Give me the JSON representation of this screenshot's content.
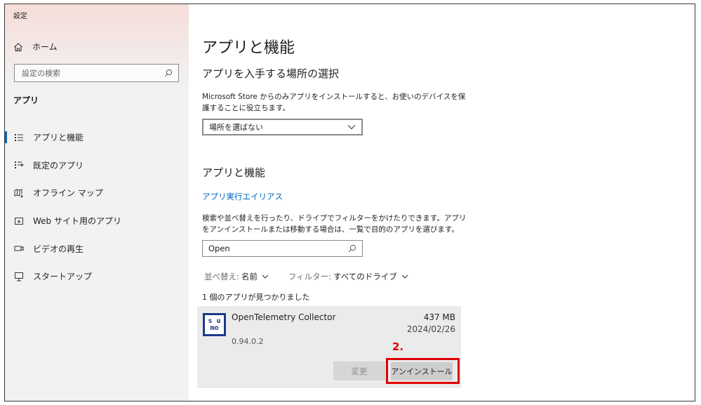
{
  "window": {
    "title": "設定"
  },
  "sidebar": {
    "home_label": "ホーム",
    "search_placeholder": "設定の検索",
    "section_title": "アプリ",
    "items": [
      {
        "label": "アプリと機能",
        "icon": "apps-features-icon",
        "active": true
      },
      {
        "label": "既定のアプリ",
        "icon": "default-apps-icon"
      },
      {
        "label": "オフライン マップ",
        "icon": "offline-maps-icon"
      },
      {
        "label": "Web サイト用のアプリ",
        "icon": "apps-for-websites-icon"
      },
      {
        "label": "ビデオの再生",
        "icon": "video-playback-icon"
      },
      {
        "label": "スタートアップ",
        "icon": "startup-icon"
      }
    ]
  },
  "main": {
    "page_title": "アプリと機能",
    "install_section": {
      "title": "アプリを入手する場所の選択",
      "description": "Microsoft Store からのみアプリをインストールすると、お使いのデバイスを保護することに役立ちます。",
      "dropdown_value": "場所を選ばない"
    },
    "features_section": {
      "title": "アプリと機能",
      "alias_link": "アプリ実行エイリアス",
      "description": "検索や並べ替えを行ったり、ドライブでフィルターをかけたりできます。アプリをアンインストールまたは移動する場合は、一覧で目的のアプリを選びます。",
      "search_value": "Open",
      "sort_label": "並べ替え:",
      "sort_value": "名前",
      "filter_label": "フィルター:",
      "filter_value": "すべてのドライブ",
      "result_count": "1 個のアプリが見つかりました"
    },
    "app_item": {
      "icon_text_top": "s u",
      "icon_text_bottom": "mo",
      "name": "OpenTelemetry Collector",
      "size": "437 MB",
      "date": "2024/02/26",
      "version": "0.94.0.2",
      "modify_label": "変更",
      "uninstall_label": "アンインストール"
    },
    "annotation": {
      "step_label": "2.",
      "color": "#e00000"
    }
  },
  "colors": {
    "accent": "#0067c0",
    "highlight": "#e00000"
  }
}
